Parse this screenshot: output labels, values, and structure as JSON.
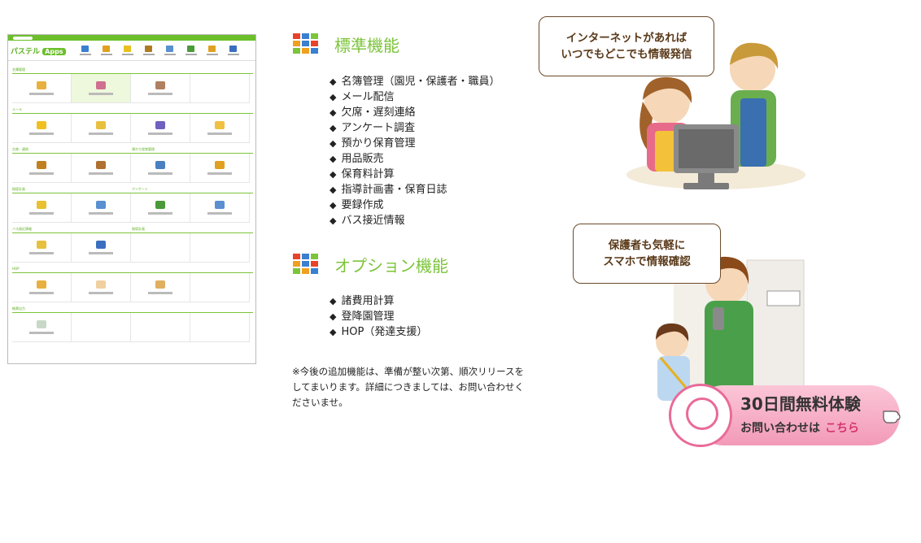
{
  "app_screenshot": {
    "logo_text": "パステル",
    "logo_apps": "Apps",
    "nav_icon_colors": [
      "#3a7fd0",
      "#e0a020",
      "#e8c020",
      "#b07a20",
      "#5a8fd0",
      "#4a9a3a",
      "#e0a020",
      "#3a6fc0"
    ],
    "sections": [
      {
        "titles": [
          "名簿管理",
          ""
        ],
        "cells": [
          {
            "icon": "#e8b040"
          },
          {
            "icon": "#d07090",
            "hl": true
          },
          {
            "icon": "#b08060"
          },
          {}
        ]
      },
      {
        "titles": [
          "メール",
          ""
        ],
        "cells": [
          {
            "icon": "#f0c020"
          },
          {
            "icon": "#e8c040"
          },
          {
            "icon": "#7060c0"
          },
          {
            "icon": "#f0c040"
          }
        ]
      },
      {
        "titles": [
          "欠席・遅刻",
          "預かり保育管理"
        ],
        "cells": [
          {
            "icon": "#c08020"
          },
          {
            "icon": "#b07030"
          },
          {
            "icon": "#4a80c0"
          },
          {
            "icon": "#e0a020"
          }
        ]
      },
      {
        "titles": [
          "指導計画",
          "アンケート"
        ],
        "cells": [
          {
            "icon": "#e8c030"
          },
          {
            "icon": "#5a8fd0"
          },
          {
            "icon": "#4a9a3a"
          },
          {
            "icon": "#5a8fd0"
          }
        ]
      },
      {
        "titles": [
          "バス接近情報",
          "指導計画"
        ],
        "cells": [
          {
            "icon": "#e8c040"
          },
          {
            "icon": "#3a6fc0"
          },
          {},
          {}
        ]
      },
      {
        "titles": [
          "HOP",
          ""
        ],
        "cells": [
          {
            "icon": "#e8b040"
          },
          {
            "icon": "#f0d0a0"
          },
          {
            "icon": "#e0b060"
          },
          {}
        ]
      },
      {
        "titles": [
          "帳票出力",
          ""
        ],
        "cells": [
          {
            "icon": "#c8d8c8"
          },
          {},
          {},
          {}
        ]
      }
    ]
  },
  "standard": {
    "title": "標準機能",
    "items": [
      "名簿管理（園児・保護者・職員）",
      "メール配信",
      "欠席・遅刻連絡",
      "アンケート調査",
      "預かり保育管理",
      "用品販売",
      "保育料計算",
      "指導計画書・保育日誌",
      "要録作成",
      "バス接近情報"
    ]
  },
  "option": {
    "title": "オプション機能",
    "items": [
      "諸費用計算",
      "登降園管理",
      "HOP（発達支援）"
    ]
  },
  "note": "※今後の追加機能は、準備が整い次第、順次リリースをしてまいります。詳細につきましては、お問い合わせくださいませ。",
  "bubble1": {
    "line1": "インターネットがあれば",
    "line2": "いつでもどこでも情報発信"
  },
  "bubble2": {
    "line1": "保護者も気軽に",
    "line2": "スマホで情報確認"
  },
  "cta": {
    "main": "30日間無料体験",
    "sub": "お問い合わせは",
    "link": "こちら"
  },
  "icon_colors": [
    "#e8432a",
    "#3a7fd0",
    "#7cc43a",
    "#f0a020",
    "#3a7fd0",
    "#e8432a",
    "#7cc43a",
    "#f0a020",
    "#3a7fd0"
  ],
  "colors": {
    "accent_green": "#7cc43a",
    "cta_pink": "#e96a98"
  }
}
